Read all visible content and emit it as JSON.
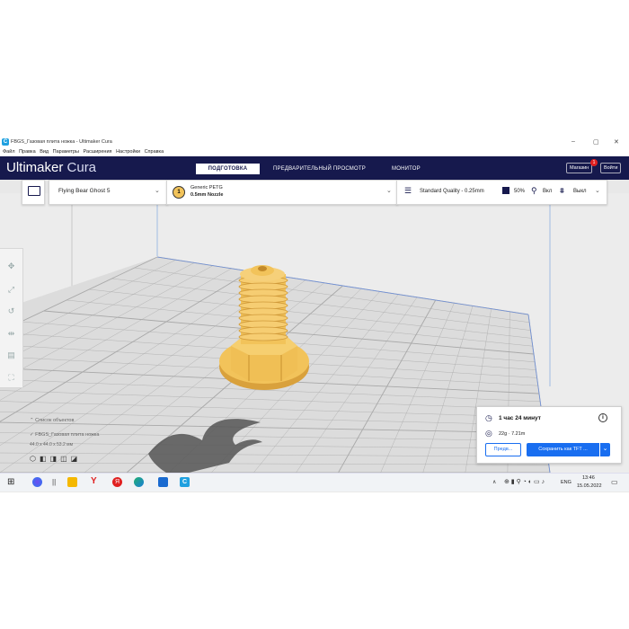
{
  "window": {
    "title": "FBGS_Газовая плита ножка - Ultimaker Cura",
    "app_icon": "cura-icon"
  },
  "menu": [
    "Файл",
    "Правка",
    "Вид",
    "Параметры",
    "Расширения",
    "Настройки",
    "Справка"
  ],
  "header": {
    "logo_main": "Ultimaker",
    "logo_sub": "Cura",
    "stages": [
      "ПОДГОТОВКА",
      "ПРЕДВАРИТЕЛЬНЫЙ ПРОСМОТР",
      "МОНИТОР"
    ],
    "active_stage": "ПОДГОТОВКА",
    "marketplace": "Магазин",
    "marketplace_badge": "1",
    "signin": "Войти"
  },
  "toolbar": {
    "printer": "Flying Bear Ghost 5",
    "extruder_number": "1",
    "material": "Generic PETG",
    "nozzle": "0.5mm Nozzle",
    "quality": "Standard Quality - 0.25mm",
    "infill": "50%",
    "support": "Вкл",
    "adhesion": "Выкл"
  },
  "objects": {
    "list_title": "Список объектов",
    "item": "FBGS_Газовая плита ножка",
    "dimensions": "44.0 x 44.0 x 53.2 мм"
  },
  "print_panel": {
    "time": "1 час 24 минут",
    "material": "22g · 7.21m",
    "preview_button": "Предв...",
    "save_button": "Сохранить как TFT ..."
  },
  "taskbar": {
    "language": "ENG",
    "time": "13:46",
    "date": "15.05.2022"
  },
  "colors": {
    "header": "#16194d",
    "accent": "#196ef0",
    "model": "#f2c35a",
    "model_shade": "#d9a13c",
    "plate": "#dcdcdc",
    "grid": "#9a9a9a"
  }
}
